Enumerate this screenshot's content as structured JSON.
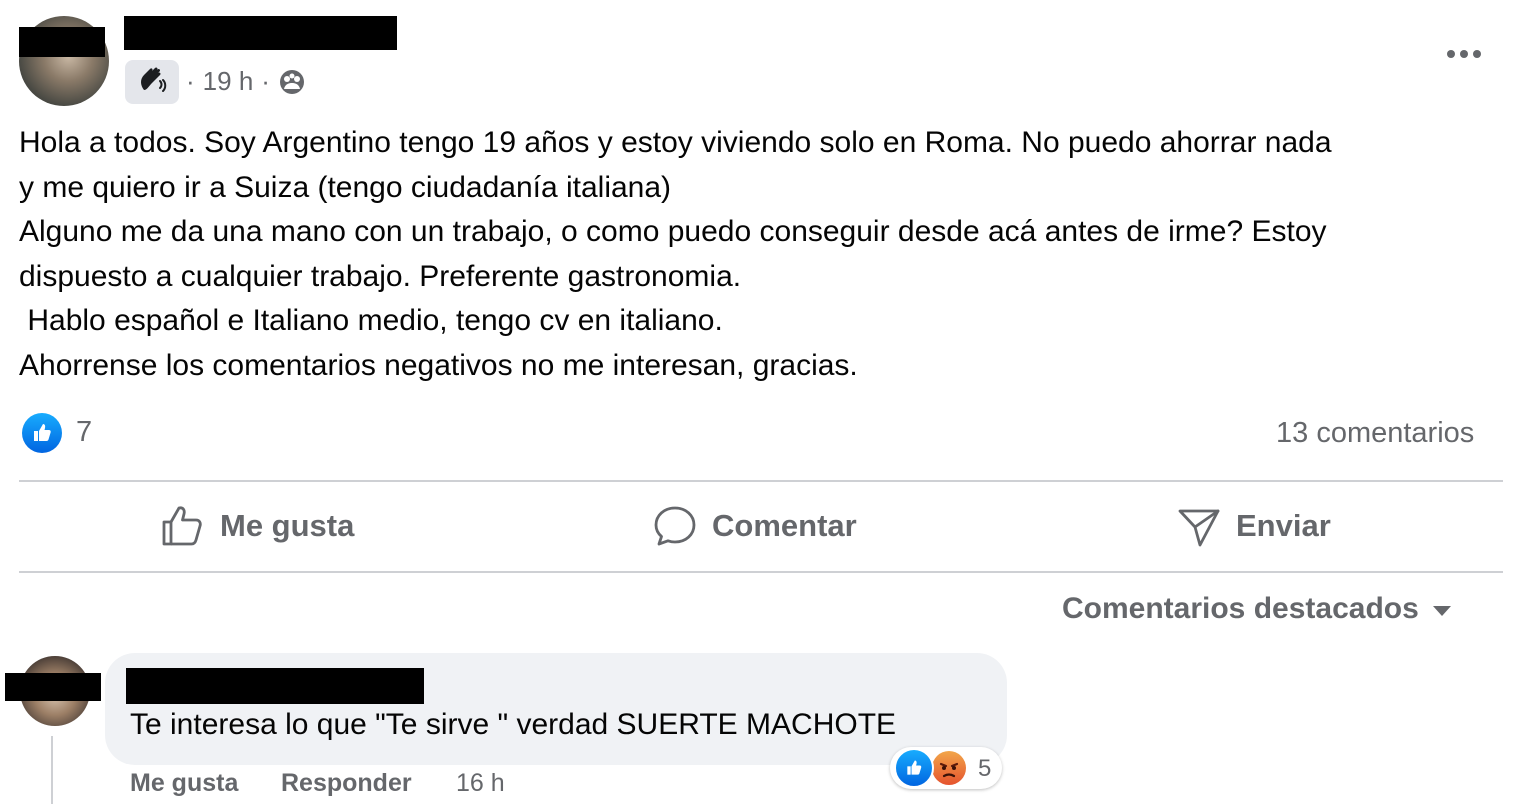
{
  "post": {
    "time": "19 h",
    "separator": "·",
    "text": "Hola a todos. Soy Argentino tengo 19 años y estoy viviendo solo en Roma. No puedo ahorrar nada\ny me quiero ir a Suiza (tengo ciudadanía italiana)\nAlguno me da una mano con un trabajo, o como puedo conseguir desde acá antes de irme? Estoy\ndispuesto a cualquier trabajo. Preferente gastronomia.\n Hablo español e Italiano medio, tengo cv en italiano.\nAhorrense los comentarios negativos no me interesan, gracias.",
    "reaction_count": "7",
    "comment_count": "13 comentarios"
  },
  "actions": {
    "like": "Me gusta",
    "comment": "Comentar",
    "send": "Enviar"
  },
  "comments_filter": "Comentarios destacados",
  "comment": {
    "text": "Te interesa lo que \"Te sirve \" verdad SUERTE MACHOTE",
    "like_label": "Me gusta",
    "reply_label": "Responder",
    "time": "16 h",
    "reaction_count": "5"
  },
  "icons": {
    "more": "more-horizontal-icon",
    "badge": "wave-hand-icon",
    "audience": "audience-icon",
    "like": "thumbs-up-icon",
    "comment": "comment-bubble-icon",
    "send": "send-icon",
    "dropdown": "caret-down-icon"
  },
  "colors": {
    "like_blue": "#0866ff",
    "muted": "#65676b",
    "bubble": "#f0f2f5"
  }
}
